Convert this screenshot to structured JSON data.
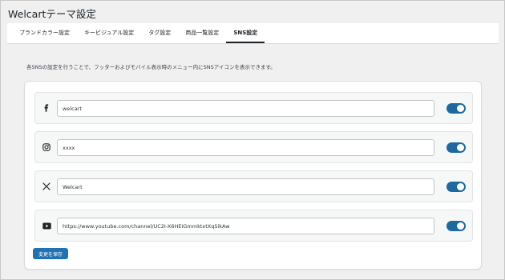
{
  "page": {
    "title": "Welcartテーマ設定"
  },
  "tabs": [
    {
      "label": "ブランドカラー設定",
      "active": false
    },
    {
      "label": "キービジュアル設定",
      "active": false
    },
    {
      "label": "タグ設定",
      "active": false
    },
    {
      "label": "商品一覧設定",
      "active": false
    },
    {
      "label": "SNS設定",
      "active": true
    }
  ],
  "description": "各SNSの設定を行うことで、フッターおよびモバイル表示時のメニュー内にSNSアイコンを表示できます。",
  "sns": [
    {
      "icon": "facebook-icon",
      "value": "welcart",
      "enabled": true
    },
    {
      "icon": "instagram-icon",
      "value": "xxxx",
      "enabled": true
    },
    {
      "icon": "x-icon",
      "value": "Welcart",
      "enabled": true
    },
    {
      "icon": "youtube-icon",
      "value": "https://www.youtube.com/channel/UC2I-X6HEIGmmktxtXqSikAw",
      "enabled": true
    }
  ],
  "colors": {
    "accent": "#2271b1",
    "toggle_on": "#1e6a9e",
    "background": "#f0f0f1"
  },
  "save_button": {
    "label": "変更を保存"
  }
}
